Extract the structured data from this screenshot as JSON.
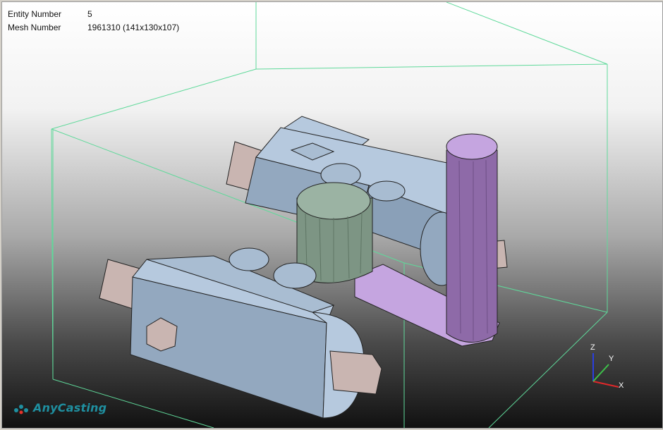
{
  "info": {
    "entity_label": "Entity Number",
    "entity_value": "5",
    "mesh_label": "Mesh Number",
    "mesh_value": "1961310 (141x130x107)"
  },
  "logo": {
    "text": "AnyCasting"
  },
  "axes": {
    "z": "Z",
    "y": "Y",
    "x": "X"
  },
  "colors": {
    "bounding_box": "#5fd99a",
    "motor_body": "#b6c9de",
    "motor_face": "#93a8bf",
    "shaft": "#c9b5b1",
    "mold_green": "#9bb3a3",
    "mold_purple": "#c5a5e0",
    "axis_x": "#e0282a",
    "axis_y": "#3ec24a",
    "axis_z": "#2a3fe0"
  }
}
